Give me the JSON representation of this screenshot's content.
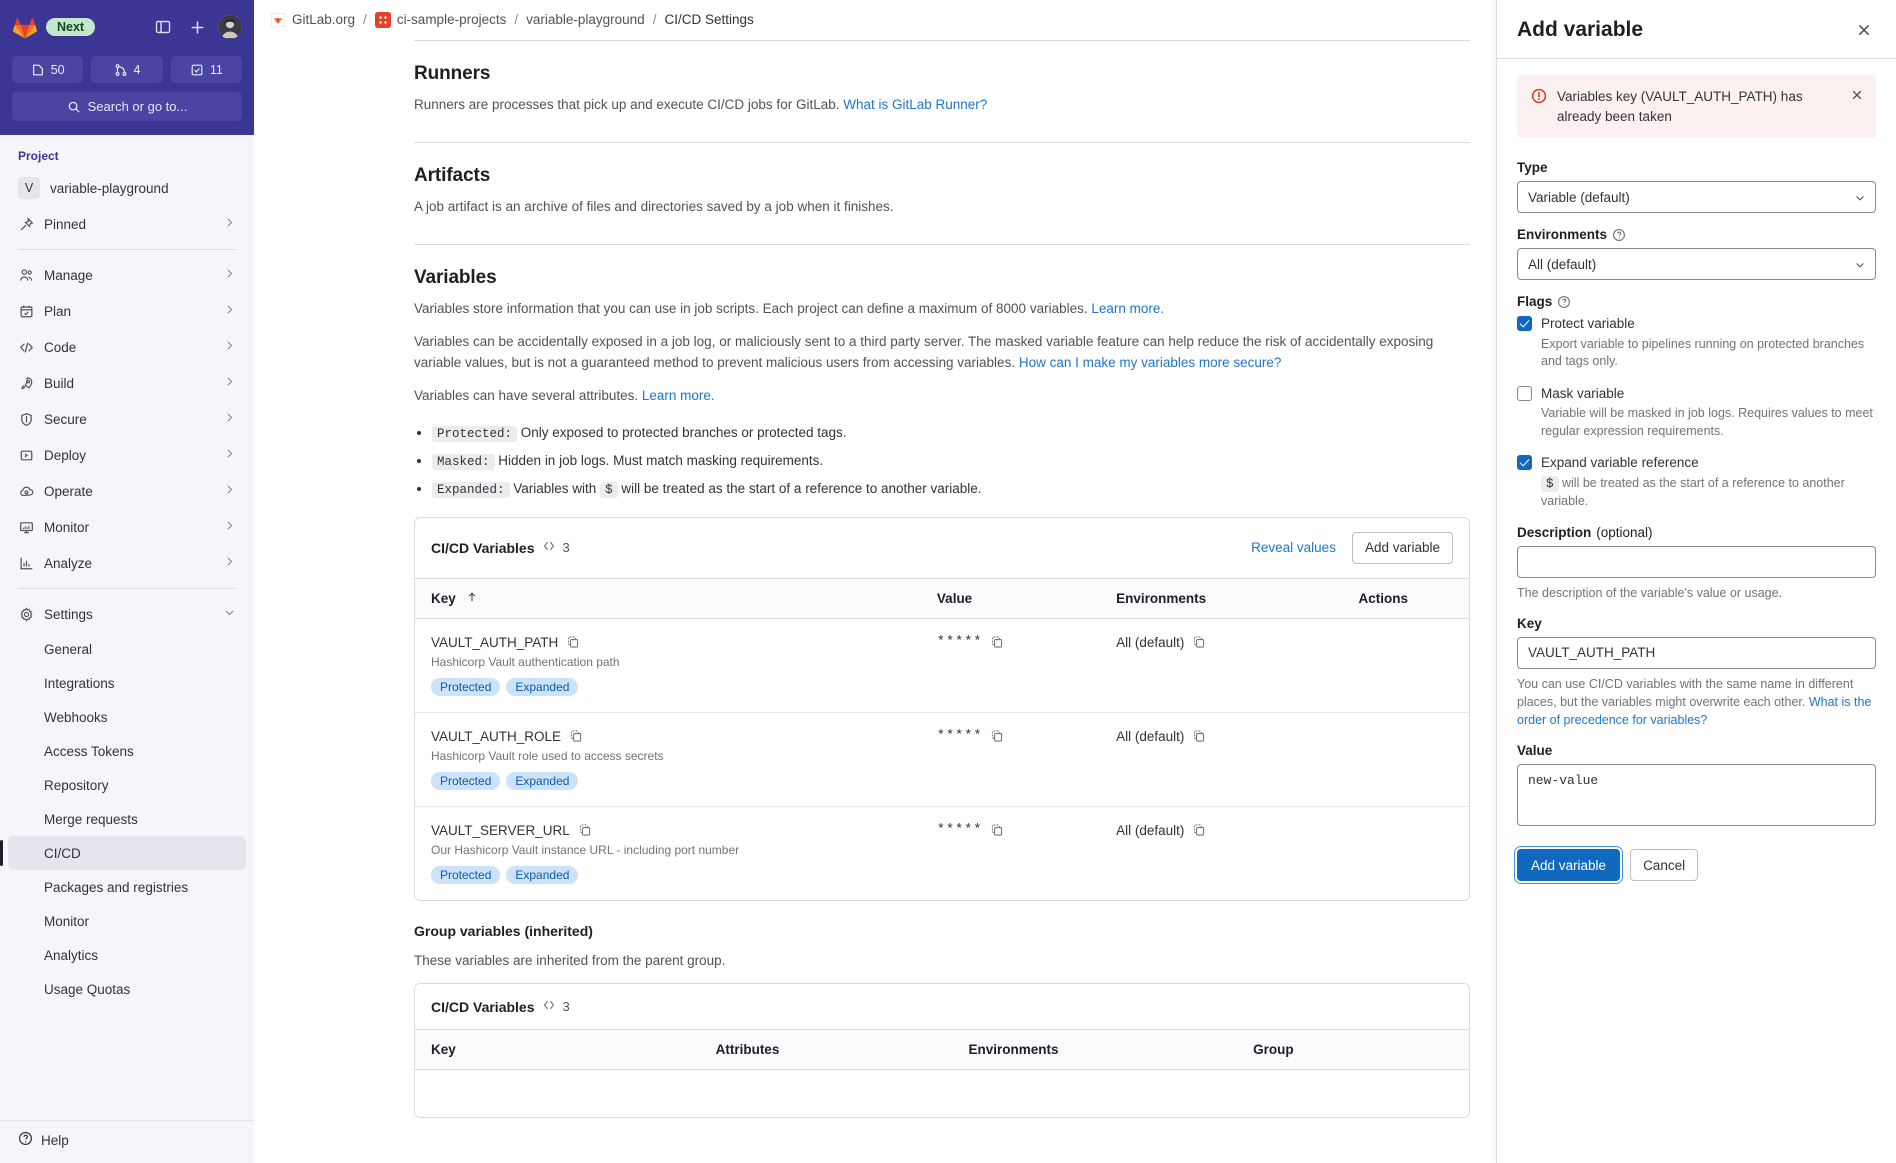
{
  "sidebar": {
    "brand": {
      "next_badge": "Next",
      "logo_icon": "gitlab-logo-icon",
      "panel_icon": "toggle-sidebar-icon",
      "plus_icon": "create-new-icon",
      "avatar_icon": "user-avatar"
    },
    "counts": [
      {
        "icon": "issues-icon",
        "value": "50",
        "name": "issues-count"
      },
      {
        "icon": "merge-request-icon",
        "value": "4",
        "name": "merge-requests-count"
      },
      {
        "icon": "todo-icon",
        "value": "11",
        "name": "todos-count"
      }
    ],
    "search_placeholder": "Search or go to...",
    "section_title": "Project",
    "project": {
      "initial": "V",
      "name": "variable-playground"
    },
    "items": [
      {
        "label": "Pinned",
        "icon": "pin-icon",
        "chevron": true
      },
      {
        "label": "Manage",
        "icon": "users-icon",
        "chevron": true
      },
      {
        "label": "Plan",
        "icon": "calendar-icon",
        "chevron": true
      },
      {
        "label": "Code",
        "icon": "code-icon",
        "chevron": true
      },
      {
        "label": "Build",
        "icon": "rocket-icon",
        "chevron": true
      },
      {
        "label": "Secure",
        "icon": "shield-icon",
        "chevron": true
      },
      {
        "label": "Deploy",
        "icon": "deploy-icon",
        "chevron": true
      },
      {
        "label": "Operate",
        "icon": "cloud-icon",
        "chevron": true
      },
      {
        "label": "Monitor",
        "icon": "monitor-icon",
        "chevron": true
      },
      {
        "label": "Analyze",
        "icon": "chart-icon",
        "chevron": true
      },
      {
        "label": "Settings",
        "icon": "gear-icon",
        "chevron": true
      }
    ],
    "settings_items": [
      {
        "label": "General",
        "active": false
      },
      {
        "label": "Integrations",
        "active": false
      },
      {
        "label": "Webhooks",
        "active": false
      },
      {
        "label": "Access Tokens",
        "active": false
      },
      {
        "label": "Repository",
        "active": false
      },
      {
        "label": "Merge requests",
        "active": false
      },
      {
        "label": "CI/CD",
        "active": true
      },
      {
        "label": "Packages and registries",
        "active": false
      },
      {
        "label": "Monitor",
        "active": false
      },
      {
        "label": "Analytics",
        "active": false
      },
      {
        "label": "Usage Quotas",
        "active": false
      }
    ],
    "help_label": "Help",
    "help_icon": "help-icon"
  },
  "breadcrumb": {
    "items": [
      {
        "label": "GitLab.org",
        "icon": "gitlab-org-icon"
      },
      {
        "label": "ci-sample-projects",
        "icon": "project-group-icon"
      },
      {
        "label": "variable-playground",
        "icon": null
      },
      {
        "label": "CI/CD Settings",
        "icon": null
      }
    ],
    "separator": "/"
  },
  "main": {
    "runners": {
      "heading": "Runners",
      "desc_prefix": "Runners are processes that pick up and execute CI/CD jobs for GitLab. ",
      "link": "What is GitLab Runner?"
    },
    "artifacts": {
      "heading": "Artifacts",
      "desc": "A job artifact is an archive of files and directories saved by a job when it finishes."
    },
    "variables": {
      "heading": "Variables",
      "p1_prefix": "Variables store information that you can use in job scripts. Each project can define a maximum of 8000 variables. ",
      "p1_link": "Learn more.",
      "p2_prefix": "Variables can be accidentally exposed in a job log, or maliciously sent to a third party server. The masked variable feature can help reduce the risk of accidentally exposing variable values, but is not a guaranteed method to prevent malicious users from accessing variables. ",
      "p2_link": "How can I make my variables more secure?",
      "p3_prefix": "Variables can have several attributes. ",
      "p3_link": "Learn more.",
      "attributes": [
        {
          "code": "Protected:",
          "text": "Only exposed to protected branches or protected tags."
        },
        {
          "code": "Masked:",
          "text": "Hidden in job logs. Must match masking requirements."
        },
        {
          "code": "Expanded:",
          "text_before": "Variables with ",
          "inline_code": "$",
          "text_after": " will be treated as the start of a reference to another variable."
        }
      ]
    },
    "vars_card": {
      "title": "CI/CD Variables",
      "count": "3",
      "count_icon": "code-brackets-icon",
      "reveal_label": "Reveal values",
      "add_label": "Add variable",
      "columns": [
        "Key",
        "Value",
        "Environments",
        "Actions"
      ],
      "sort_icon": "sort-asc-icon",
      "rows": [
        {
          "key": "VAULT_AUTH_PATH",
          "description": "Hashicorp Vault authentication path",
          "badges": [
            "Protected",
            "Expanded"
          ],
          "value": "*****",
          "environment": "All (default)"
        },
        {
          "key": "VAULT_AUTH_ROLE",
          "description": "Hashicorp Vault role used to access secrets",
          "badges": [
            "Protected",
            "Expanded"
          ],
          "value": "*****",
          "environment": "All (default)"
        },
        {
          "key": "VAULT_SERVER_URL",
          "description": "Our Hashicorp Vault instance URL - including port number",
          "badges": [
            "Protected",
            "Expanded"
          ],
          "value": "*****",
          "environment": "All (default)"
        }
      ]
    },
    "group_vars": {
      "heading": "Group variables (inherited)",
      "desc": "These variables are inherited from the parent group.",
      "card_title": "CI/CD Variables",
      "card_count": "3",
      "columns": [
        "Key",
        "Attributes",
        "Environments",
        "Group"
      ]
    }
  },
  "drawer": {
    "title": "Add variable",
    "close_icon": "close-icon",
    "alert": {
      "icon": "error-icon",
      "text": "Variables key (VAULT_AUTH_PATH) has already been taken",
      "dismiss_icon": "close-icon"
    },
    "type": {
      "label": "Type",
      "value": "Variable (default)"
    },
    "environments": {
      "label": "Environments",
      "help_icon": "question-icon",
      "value": "All (default)"
    },
    "flags": {
      "label": "Flags",
      "help_icon": "question-icon",
      "items": [
        {
          "title": "Protect variable",
          "desc": "Export variable to pipelines running on protected branches and tags only.",
          "checked": true
        },
        {
          "title": "Mask variable",
          "desc": "Variable will be masked in job logs. Requires values to meet regular expression requirements.",
          "checked": false
        },
        {
          "title": "Expand variable reference",
          "desc_code": "$",
          "desc_before": "",
          "desc_after": " will be treated as the start of a reference to another variable.",
          "checked": true
        }
      ]
    },
    "description": {
      "label": "Description",
      "optional": " (optional)",
      "value": "",
      "help": "The description of the variable's value or usage."
    },
    "key": {
      "label": "Key",
      "value": "VAULT_AUTH_PATH",
      "help_prefix": "You can use CI/CD variables with the same name in different places, but the variables might overwrite each other. ",
      "help_link": "What is the order of precedence for variables?"
    },
    "value_field": {
      "label": "Value",
      "value": "new-value"
    },
    "submit_label": "Add variable",
    "cancel_label": "Cancel"
  }
}
